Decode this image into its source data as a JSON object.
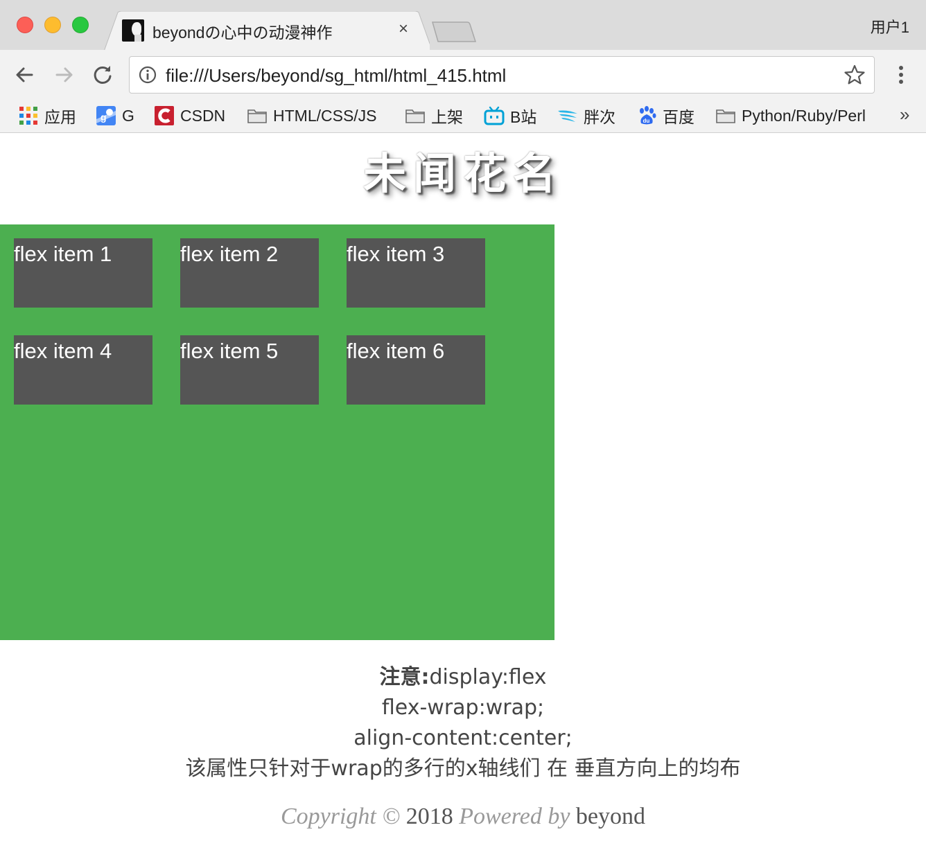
{
  "browser": {
    "tab_title": "beyondの心中の动漫神作",
    "tab_close": "×",
    "user_label": "用户1",
    "url": "file:///Users/beyond/sg_html/html_415.html",
    "bookmarks": [
      {
        "label": "应用",
        "icon": "apps-grid-icon"
      },
      {
        "label": "G",
        "icon": "google-maps-icon"
      },
      {
        "label": "CSDN",
        "icon": "csdn-icon"
      },
      {
        "label": "HTML/CSS/JS",
        "icon": "folder-icon"
      },
      {
        "label": "上架",
        "icon": "folder-icon"
      },
      {
        "label": "B站",
        "icon": "bilibili-icon"
      },
      {
        "label": "胖次",
        "icon": "wings-icon"
      },
      {
        "label": "百度",
        "icon": "baidu-paw-icon"
      },
      {
        "label": "Python/Ruby/Perl",
        "icon": "folder-icon"
      }
    ],
    "bookmarks_more": "»"
  },
  "page": {
    "heading": "未闻花名",
    "flex_items": [
      "flex item 1",
      "flex item 2",
      "flex item 3",
      "flex item 4",
      "flex item 5",
      "flex item 6"
    ],
    "container_color": "#4caf50",
    "item_color": "#555555",
    "notes": {
      "label": "注意:",
      "line1": "display:flex",
      "line2": "flex-wrap:wrap;",
      "line3": "align-content:center;",
      "line4": "该属性只针对于wrap的多行的x轴线们 在 垂直方向上的均布"
    },
    "copyright": {
      "prefix": "Copyright © ",
      "year": "2018",
      "powered": " Powered by ",
      "author": "beyond"
    }
  }
}
